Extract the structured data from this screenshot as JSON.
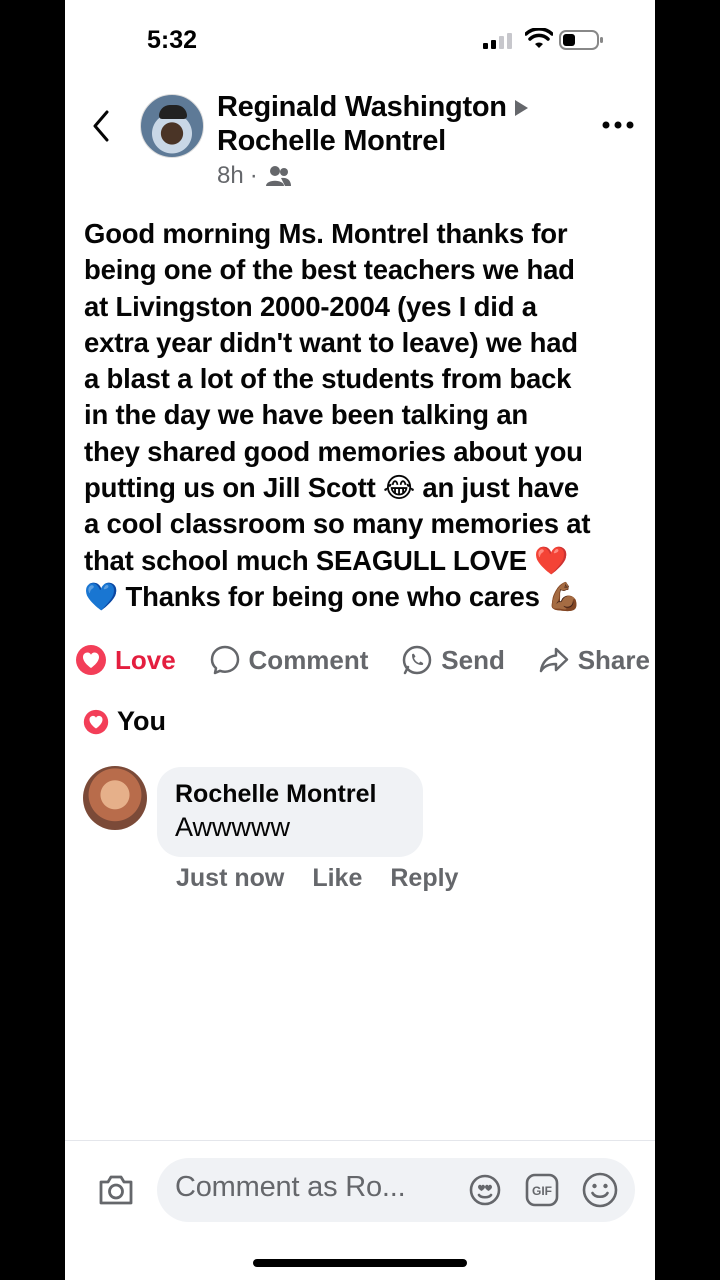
{
  "status_bar": {
    "time": "5:32"
  },
  "post": {
    "author": "Reginald Washington",
    "recipient": "Rochelle Montrel",
    "time": "8h",
    "separator": "·",
    "text_lines": [
      "Good morning Ms. Montrel thanks for",
      "being one of the best teachers we had",
      "at Livingston 2000-2004 (yes I did a",
      "extra year didn't want to leave) we had",
      "a blast a lot of the students from back",
      "in the day we have been talking an",
      "they shared good memories about you",
      "putting us on Jill Scott",
      "a cool classroom so many memories at",
      "that school much SEAGULL LOVE",
      "Thanks for being one who cares"
    ],
    "emoji": {
      "laugh": "😂",
      "after_laugh": " an just have",
      "heart_red": "❤️",
      "heart_blue": "💙",
      "muscle": "💪🏾"
    }
  },
  "actions": {
    "love": "Love",
    "comment": "Comment",
    "send": "Send",
    "share": "Share"
  },
  "reactions": {
    "label": "You"
  },
  "comment": {
    "author": "Rochelle Montrel",
    "text": "Awwwww",
    "time": "Just now",
    "like": "Like",
    "reply": "Reply"
  },
  "composer": {
    "placeholder": "Comment as Ro..."
  },
  "colors": {
    "love_red": "#e41e3f",
    "secondary_text": "#65676b",
    "bubble_bg": "#f0f2f5"
  },
  "icons": [
    "back-icon",
    "people-icon",
    "more-icon",
    "love-icon",
    "comment-icon",
    "send-icon",
    "share-icon",
    "camera-icon",
    "avatar-sticker-icon",
    "gif-icon",
    "emoji-icon"
  ]
}
